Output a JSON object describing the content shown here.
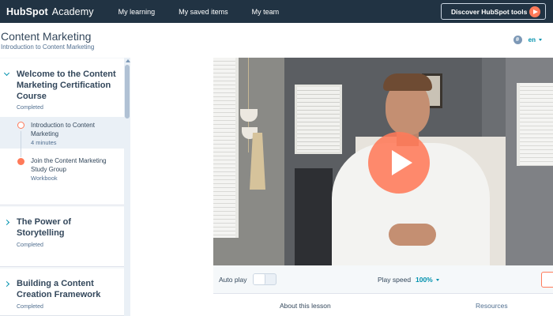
{
  "topnav": {
    "logo_text": "HubSpot",
    "logo_suffix": "Academy",
    "links": [
      "My learning",
      "My saved items",
      "My team"
    ],
    "discover_label": "Discover HubSpot tools"
  },
  "header": {
    "title": "Content Marketing",
    "subtitle": "Introduction to Content Marketing",
    "language": "en"
  },
  "sidebar": {
    "sections": [
      {
        "title": "Welcome to the Content Marketing Certification Course",
        "status": "Completed",
        "lessons": [
          {
            "title": "Introduction to Content Marketing",
            "meta": "4 minutes"
          },
          {
            "title": "Join the Content Marketing Study Group",
            "meta": "Workbook"
          }
        ]
      },
      {
        "title": "The Power of Storytelling",
        "status": "Completed"
      },
      {
        "title": "Building a Content Creation Framework",
        "status": "Completed"
      }
    ]
  },
  "controls": {
    "autoplay_label": "Auto play",
    "play_speed_label": "Play speed",
    "play_speed_value": "100%"
  },
  "tabs": [
    "About this lesson",
    "Resources"
  ],
  "colors": {
    "nav_bg": "#213343",
    "accent": "#ff7a59",
    "link": "#0091ae"
  }
}
